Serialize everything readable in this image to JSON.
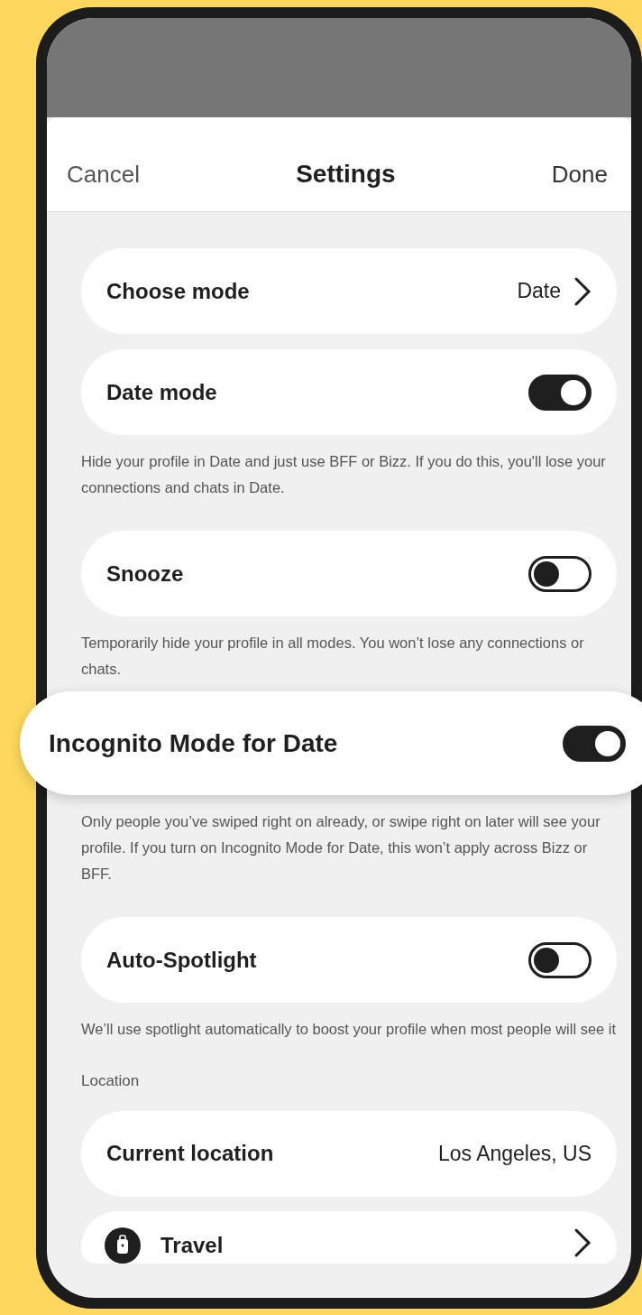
{
  "header": {
    "cancel": "Cancel",
    "title": "Settings",
    "done": "Done"
  },
  "items": [
    {
      "kind": "nav",
      "label": "Choose mode",
      "value": "Date"
    },
    {
      "kind": "toggle",
      "label": "Date mode",
      "on": true,
      "highlighted": false
    },
    {
      "kind": "description",
      "text": "Hide your profile in Date and just use BFF or Bizz. If you do this, you'll lose your connections and chats in Date."
    },
    {
      "kind": "toggle",
      "label": "Snooze",
      "on": false,
      "highlighted": false
    },
    {
      "kind": "description",
      "text": "Temporarily hide your profile in all modes. You won’t lose any connections or chats."
    },
    {
      "kind": "toggle",
      "label": "Incognito Mode for Date",
      "on": true,
      "highlighted": true
    },
    {
      "kind": "description",
      "text": "Only people you’ve swiped right on already, or swipe right on later will see your profile. If you turn on Incognito Mode for Date, this won’t apply across Bizz or BFF."
    },
    {
      "kind": "toggle",
      "label": "Auto-Spotlight",
      "on": false,
      "highlighted": false
    },
    {
      "kind": "description",
      "text": "We’ll use spotlight automatically to boost your profile when most people will see it"
    },
    {
      "kind": "section",
      "text": "Location"
    },
    {
      "kind": "value",
      "label": "Current location",
      "value": "Los Angeles, US"
    },
    {
      "kind": "travel",
      "label": "Travel"
    }
  ]
}
